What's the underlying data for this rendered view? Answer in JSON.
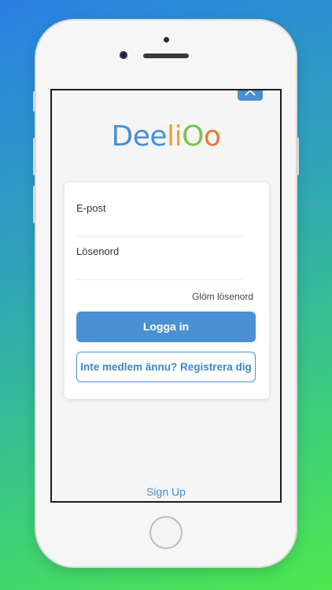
{
  "logo": {
    "letters": [
      {
        "char": "D",
        "color": "#4a90d2"
      },
      {
        "char": "e",
        "color": "#4a90d2"
      },
      {
        "char": "e",
        "color": "#4a90d2"
      },
      {
        "char": "l",
        "color": "#e8a23a"
      },
      {
        "char": "i",
        "color": "#e8a23a"
      },
      {
        "char": "O",
        "color": "#7ec24a"
      },
      {
        "char": "o",
        "color": "#e8793a"
      }
    ]
  },
  "form": {
    "email_label": "E-post",
    "password_label": "Lösenord",
    "forgot_label": "Glöm lösenord",
    "login_label": "Logga in",
    "register_label": "Inte medlem ännu? Registrera dig"
  },
  "footer": {
    "signup_label": "Sign Up"
  },
  "colors": {
    "accent": "#4a90d2"
  }
}
